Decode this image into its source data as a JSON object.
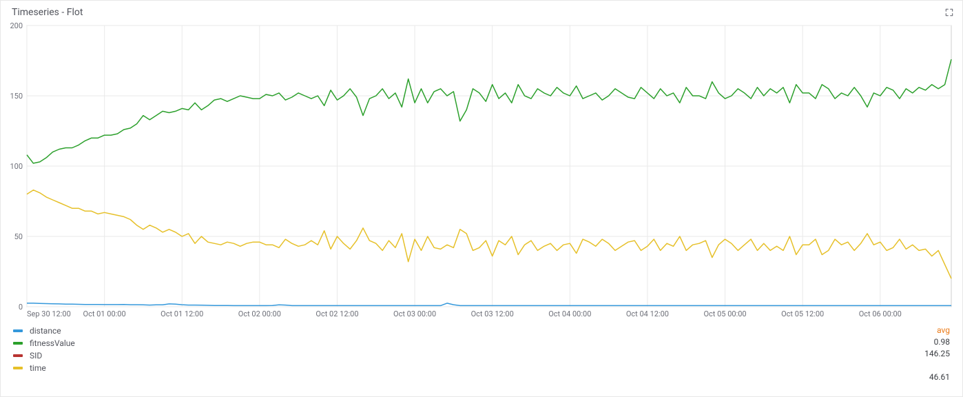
{
  "panel": {
    "title": "Timeseries - Flot"
  },
  "legend": {
    "value_header": "avg",
    "series": [
      {
        "name": "distance",
        "color": "#3498db",
        "avg": "0.98"
      },
      {
        "name": "fitnessValue",
        "color": "#2ca02c",
        "avg": "146.25"
      },
      {
        "name": "SID",
        "color": "#b83331",
        "avg": ""
      },
      {
        "name": "time",
        "color": "#e6c029",
        "avg": "46.61"
      }
    ]
  },
  "chart_data": {
    "type": "line",
    "title": "Timeseries - Flot",
    "xlabel": "",
    "ylabel": "",
    "ylim": [
      0,
      200
    ],
    "y_ticks": [
      0,
      50,
      100,
      150,
      200
    ],
    "x_categories": [
      "Sep 30 12:00",
      "",
      "",
      "",
      "",
      "",
      "",
      "",
      "",
      "",
      "",
      "",
      "Oct 01 00:00",
      "",
      "",
      "",
      "",
      "",
      "",
      "",
      "",
      "",
      "",
      "",
      "Oct 01 12:00",
      "",
      "",
      "",
      "",
      "",
      "",
      "",
      "",
      "",
      "",
      "",
      "Oct 02 00:00",
      "",
      "",
      "",
      "",
      "",
      "",
      "",
      "",
      "",
      "",
      "",
      "Oct 02 12:00",
      "",
      "",
      "",
      "",
      "",
      "",
      "",
      "",
      "",
      "",
      "",
      "Oct 03 00:00",
      "",
      "",
      "",
      "",
      "",
      "",
      "",
      "",
      "",
      "",
      "",
      "Oct 03 12:00",
      "",
      "",
      "",
      "",
      "",
      "",
      "",
      "",
      "",
      "",
      "",
      "Oct 04 00:00",
      "",
      "",
      "",
      "",
      "",
      "",
      "",
      "",
      "",
      "",
      "",
      "Oct 04 12:00",
      "",
      "",
      "",
      "",
      "",
      "",
      "",
      "",
      "",
      "",
      "",
      "Oct 05 00:00",
      "",
      "",
      "",
      "",
      "",
      "",
      "",
      "",
      "",
      "",
      "",
      "Oct 05 12:00",
      "",
      "",
      "",
      "",
      "",
      "",
      "",
      "",
      "",
      "",
      "",
      "Oct 06 00:00",
      "",
      "",
      "",
      "",
      "",
      "",
      "",
      "",
      "",
      "",
      ""
    ],
    "x_tick_labels": [
      "Sep 30 12:00",
      "Oct 01 00:00",
      "Oct 01 12:00",
      "Oct 02 00:00",
      "Oct 02 12:00",
      "Oct 03 00:00",
      "Oct 03 12:00",
      "Oct 04 00:00",
      "Oct 04 12:00",
      "Oct 05 00:00",
      "Oct 05 12:00",
      "Oct 06 00:00"
    ],
    "series": [
      {
        "name": "distance",
        "color": "#3498db",
        "values": [
          2.5,
          2.5,
          2.3,
          2.2,
          2.1,
          2.0,
          1.8,
          1.8,
          1.7,
          1.6,
          1.6,
          1.6,
          1.5,
          1.5,
          1.5,
          1.6,
          1.4,
          1.4,
          1.3,
          1.2,
          1.3,
          1.3,
          2.0,
          1.8,
          1.4,
          1.2,
          1.2,
          1.1,
          1.0,
          0.9,
          0.9,
          0.9,
          0.8,
          0.8,
          0.8,
          0.8,
          0.8,
          0.8,
          0.9,
          1.3,
          1.2,
          0.8,
          0.8,
          0.8,
          0.8,
          0.8,
          0.8,
          0.8,
          0.8,
          0.8,
          0.8,
          0.8,
          0.8,
          0.8,
          0.8,
          0.8,
          0.8,
          0.8,
          0.8,
          0.8,
          0.8,
          0.8,
          0.8,
          0.8,
          0.8,
          2.5,
          1.4,
          0.8,
          0.8,
          0.8,
          0.8,
          0.8,
          0.8,
          0.8,
          0.8,
          0.8,
          0.8,
          0.8,
          0.8,
          0.8,
          0.8,
          0.8,
          0.8,
          0.8,
          0.8,
          0.8,
          0.8,
          0.8,
          0.8,
          0.8,
          0.8,
          0.8,
          0.8,
          0.8,
          0.8,
          0.8,
          0.8,
          0.8,
          0.8,
          0.8,
          0.8,
          0.8,
          0.8,
          0.8,
          0.8,
          0.8,
          0.8,
          0.8,
          0.8,
          0.8,
          0.8,
          0.8,
          0.8,
          0.8,
          0.8,
          0.8,
          0.8,
          0.8,
          0.8,
          0.8,
          0.8,
          0.8,
          0.8,
          0.8,
          0.8,
          0.8,
          0.8,
          0.8,
          0.8,
          0.8,
          0.8,
          0.8,
          0.8,
          0.8,
          0.8,
          0.8,
          0.8,
          0.8,
          0.8,
          0.8,
          0.8,
          0.8,
          0.8,
          0.8
        ]
      },
      {
        "name": "fitnessValue",
        "color": "#2ca02c",
        "values": [
          108,
          102,
          103,
          106,
          110,
          112,
          113,
          113,
          115,
          118,
          120,
          120,
          122,
          122,
          123,
          126,
          127,
          130,
          136,
          133,
          136,
          139,
          138,
          139,
          141,
          140,
          145,
          140,
          143,
          147,
          148,
          146,
          148,
          150,
          149,
          148,
          148,
          151,
          150,
          152,
          147,
          149,
          152,
          150,
          148,
          150,
          143,
          154,
          147,
          150,
          155,
          149,
          136,
          148,
          150,
          155,
          148,
          152,
          142,
          162,
          145,
          155,
          145,
          153,
          155,
          150,
          153,
          132,
          140,
          155,
          152,
          146,
          158,
          148,
          152,
          145,
          158,
          150,
          148,
          155,
          152,
          150,
          156,
          152,
          150,
          157,
          148,
          150,
          152,
          147,
          150,
          155,
          152,
          149,
          148,
          156,
          152,
          148,
          155,
          150,
          152,
          145,
          156,
          150,
          150,
          148,
          160,
          152,
          148,
          150,
          155,
          152,
          148,
          156,
          150,
          155,
          152,
          156,
          145,
          158,
          152,
          152,
          148,
          158,
          155,
          148,
          152,
          150,
          156,
          150,
          142,
          152,
          150,
          156,
          154,
          148,
          155,
          152,
          156,
          154,
          158,
          155,
          158,
          176
        ]
      },
      {
        "name": "time",
        "color": "#e6c029",
        "values": [
          80,
          83,
          81,
          78,
          76,
          74,
          72,
          70,
          70,
          68,
          68,
          66,
          67,
          66,
          65,
          64,
          62,
          58,
          55,
          58,
          56,
          53,
          55,
          53,
          50,
          52,
          45,
          50,
          46,
          45,
          44,
          46,
          45,
          43,
          45,
          46,
          46,
          44,
          44,
          42,
          48,
          45,
          43,
          44,
          47,
          44,
          54,
          41,
          50,
          45,
          41,
          47,
          56,
          47,
          45,
          40,
          47,
          42,
          52,
          32,
          48,
          40,
          50,
          42,
          41,
          44,
          42,
          55,
          52,
          40,
          42,
          47,
          36,
          47,
          44,
          50,
          37,
          44,
          47,
          40,
          43,
          45,
          40,
          44,
          45,
          38,
          48,
          46,
          43,
          48,
          45,
          40,
          43,
          46,
          47,
          40,
          43,
          48,
          40,
          45,
          43,
          50,
          40,
          44,
          45,
          47,
          35,
          44,
          48,
          45,
          40,
          44,
          48,
          40,
          45,
          40,
          43,
          40,
          50,
          37,
          44,
          44,
          48,
          37,
          40,
          48,
          44,
          46,
          40,
          45,
          52,
          44,
          46,
          40,
          42,
          48,
          41,
          44,
          40,
          41,
          36,
          40,
          30,
          20
        ]
      }
    ]
  }
}
